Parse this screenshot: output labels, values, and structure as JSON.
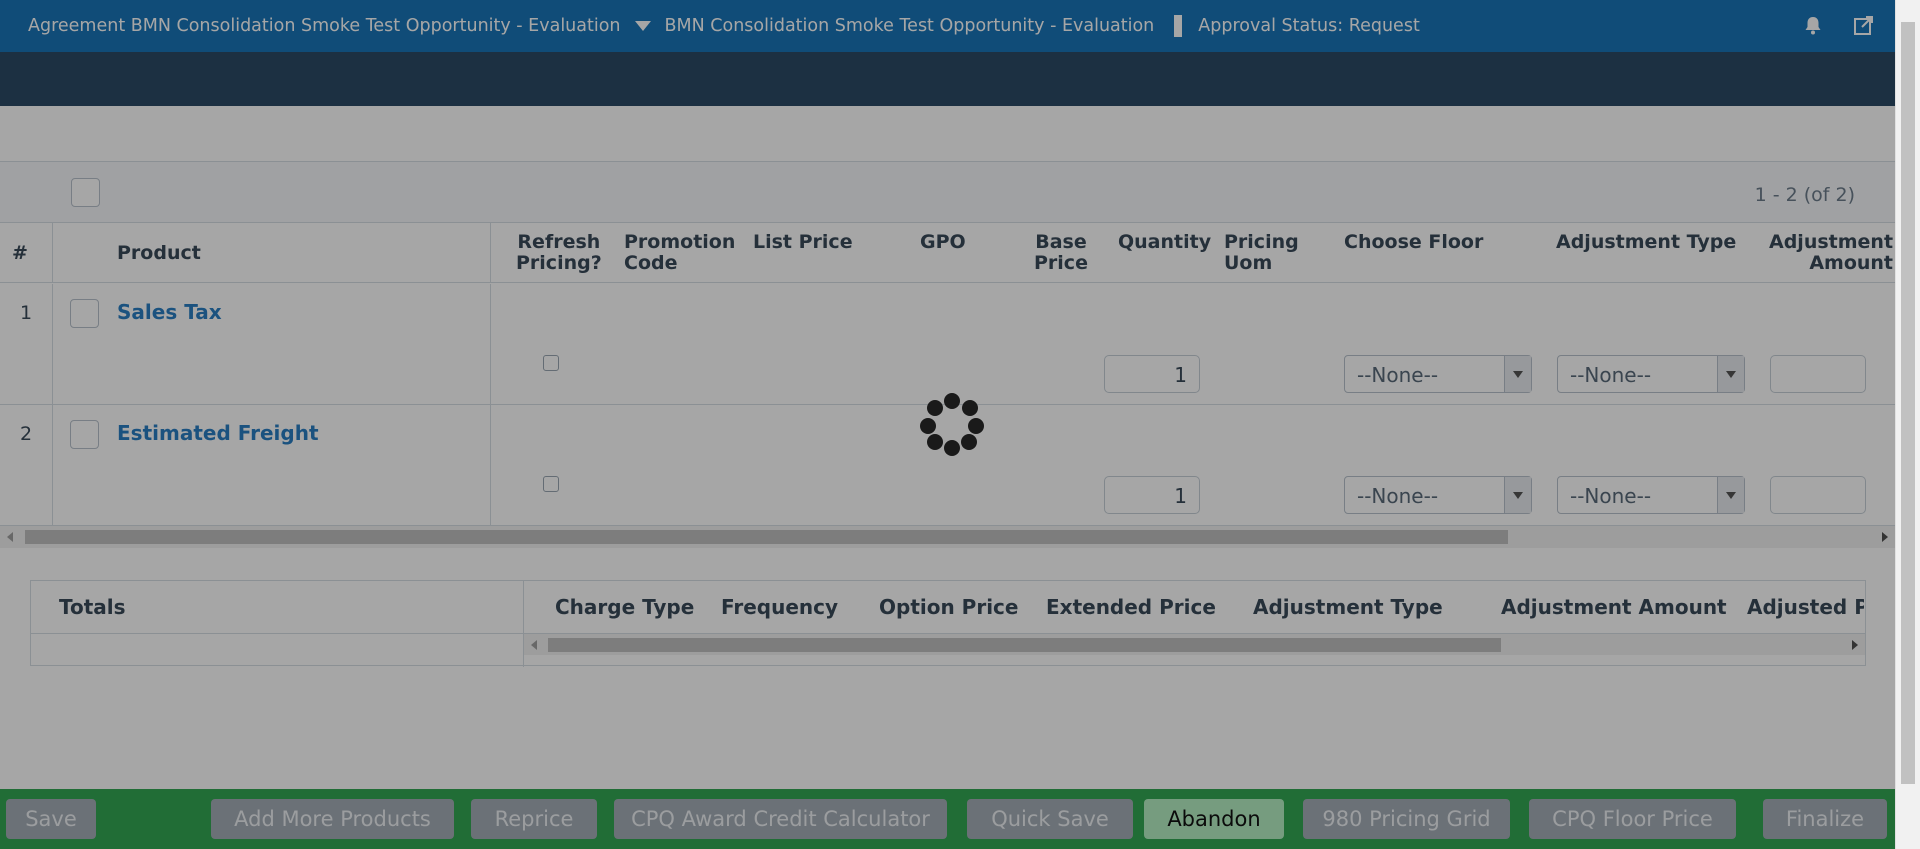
{
  "header": {
    "agreement": "Agreement BMN Consolidation Smoke Test Opportunity - Evaluation",
    "opportunity": "BMN Consolidation Smoke Test Opportunity - Evaluation",
    "approval_status": "Approval Status: Request",
    "icons": [
      "bell-icon",
      "external-link-icon"
    ]
  },
  "grid": {
    "pager": "1 - 2 (of 2)",
    "columns": {
      "num": "#",
      "product": "Product",
      "refresh": [
        "Refresh",
        "Pricing?"
      ],
      "promo": [
        "Promotion",
        "Code"
      ],
      "list_price": "List Price",
      "gpo": "GPO",
      "base_price": [
        "Base",
        "Price"
      ],
      "quantity": "Quantity",
      "pricing_uom": [
        "Pricing",
        "Uom"
      ],
      "choose_floor": "Choose Floor",
      "adjustment_type": "Adjustment Type",
      "adjustment_amount": [
        "Adjustment",
        "Amount"
      ]
    },
    "rows": [
      {
        "num": "1",
        "product": "Sales Tax",
        "quantity": "1",
        "choose_floor": "--None--",
        "adjustment_type": "--None--"
      },
      {
        "num": "2",
        "product": "Estimated Freight",
        "quantity": "1",
        "choose_floor": "--None--",
        "adjustment_type": "--None--"
      }
    ]
  },
  "totals": {
    "label": "Totals",
    "columns": [
      "Charge Type",
      "Frequency",
      "Option Price",
      "Extended Price",
      "Adjustment Type",
      "Adjustment Amount",
      "Adjusted Pri"
    ]
  },
  "footer": {
    "buttons": [
      "Save",
      "Add More Products",
      "Reprice",
      "CPQ Award Credit Calculator",
      "Quick Save",
      "Abandon",
      "980 Pricing Grid",
      "CPQ Floor Price",
      "Finalize"
    ]
  },
  "colors": {
    "header_bg": "#1a76b8",
    "subbar_bg": "#2c4a66",
    "link": "#2a7fc4",
    "footer_bg": "#34a853"
  }
}
